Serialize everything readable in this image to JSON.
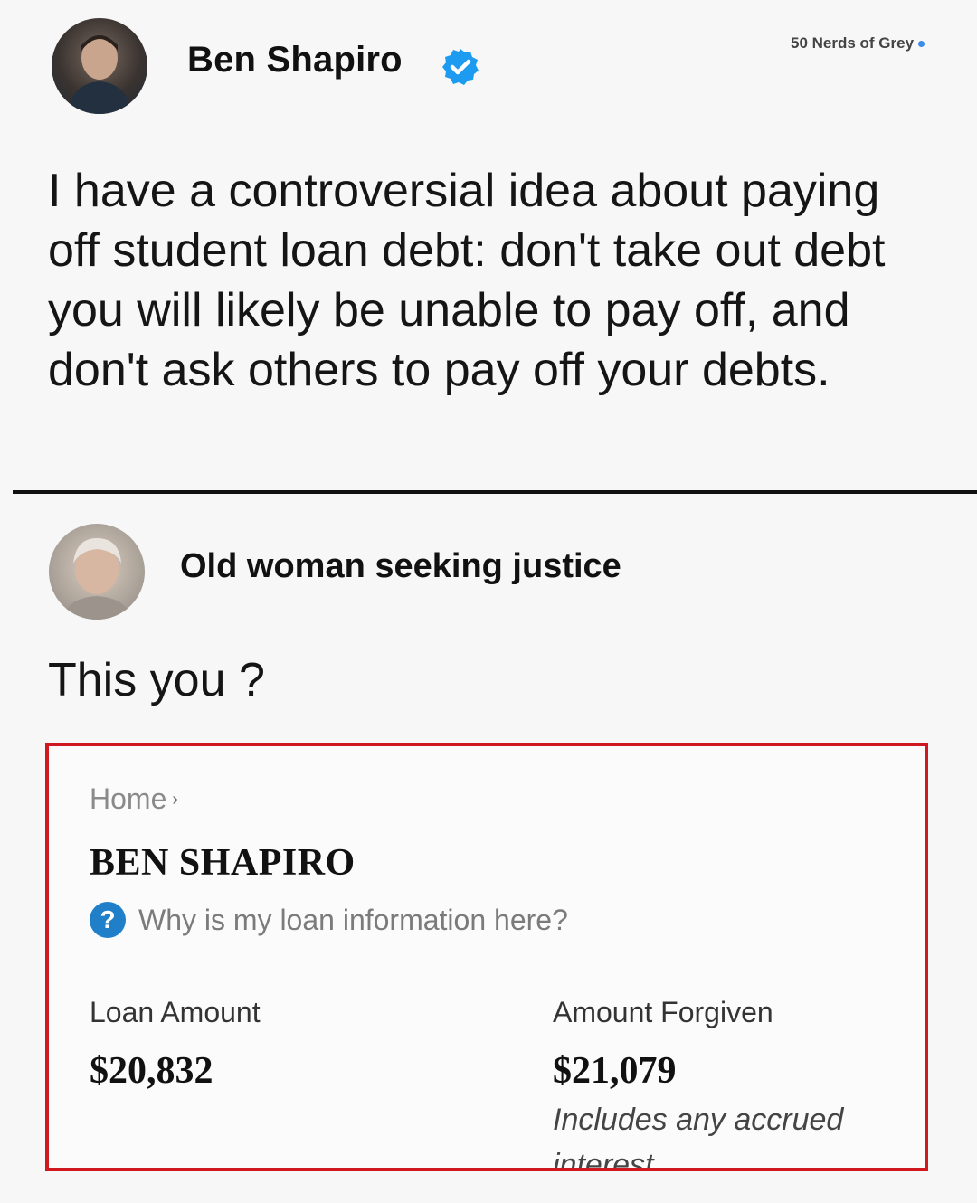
{
  "post": {
    "author": "Ben Shapiro",
    "text": "I have a controversial idea about paying off student loan debt: don't take out debt you will likely be unable to pay off, and don't ask others to pay off your debts."
  },
  "watermark": "50 Nerds of Grey",
  "reply": {
    "author": "Old woman seeking justice",
    "text": "This you ?"
  },
  "embed": {
    "breadcrumb": "Home",
    "title": "BEN SHAPIRO",
    "help_text": "Why is my loan information here?",
    "loan_label": "Loan Amount",
    "loan_value": "$20,832",
    "forgiven_label": "Amount Forgiven",
    "forgiven_value": "$21,079",
    "forgiven_note": "Includes any accrued interest"
  },
  "colors": {
    "verified": "#1d9bf0",
    "highlight_border": "#d01820",
    "help_icon": "#1f7fc9"
  }
}
